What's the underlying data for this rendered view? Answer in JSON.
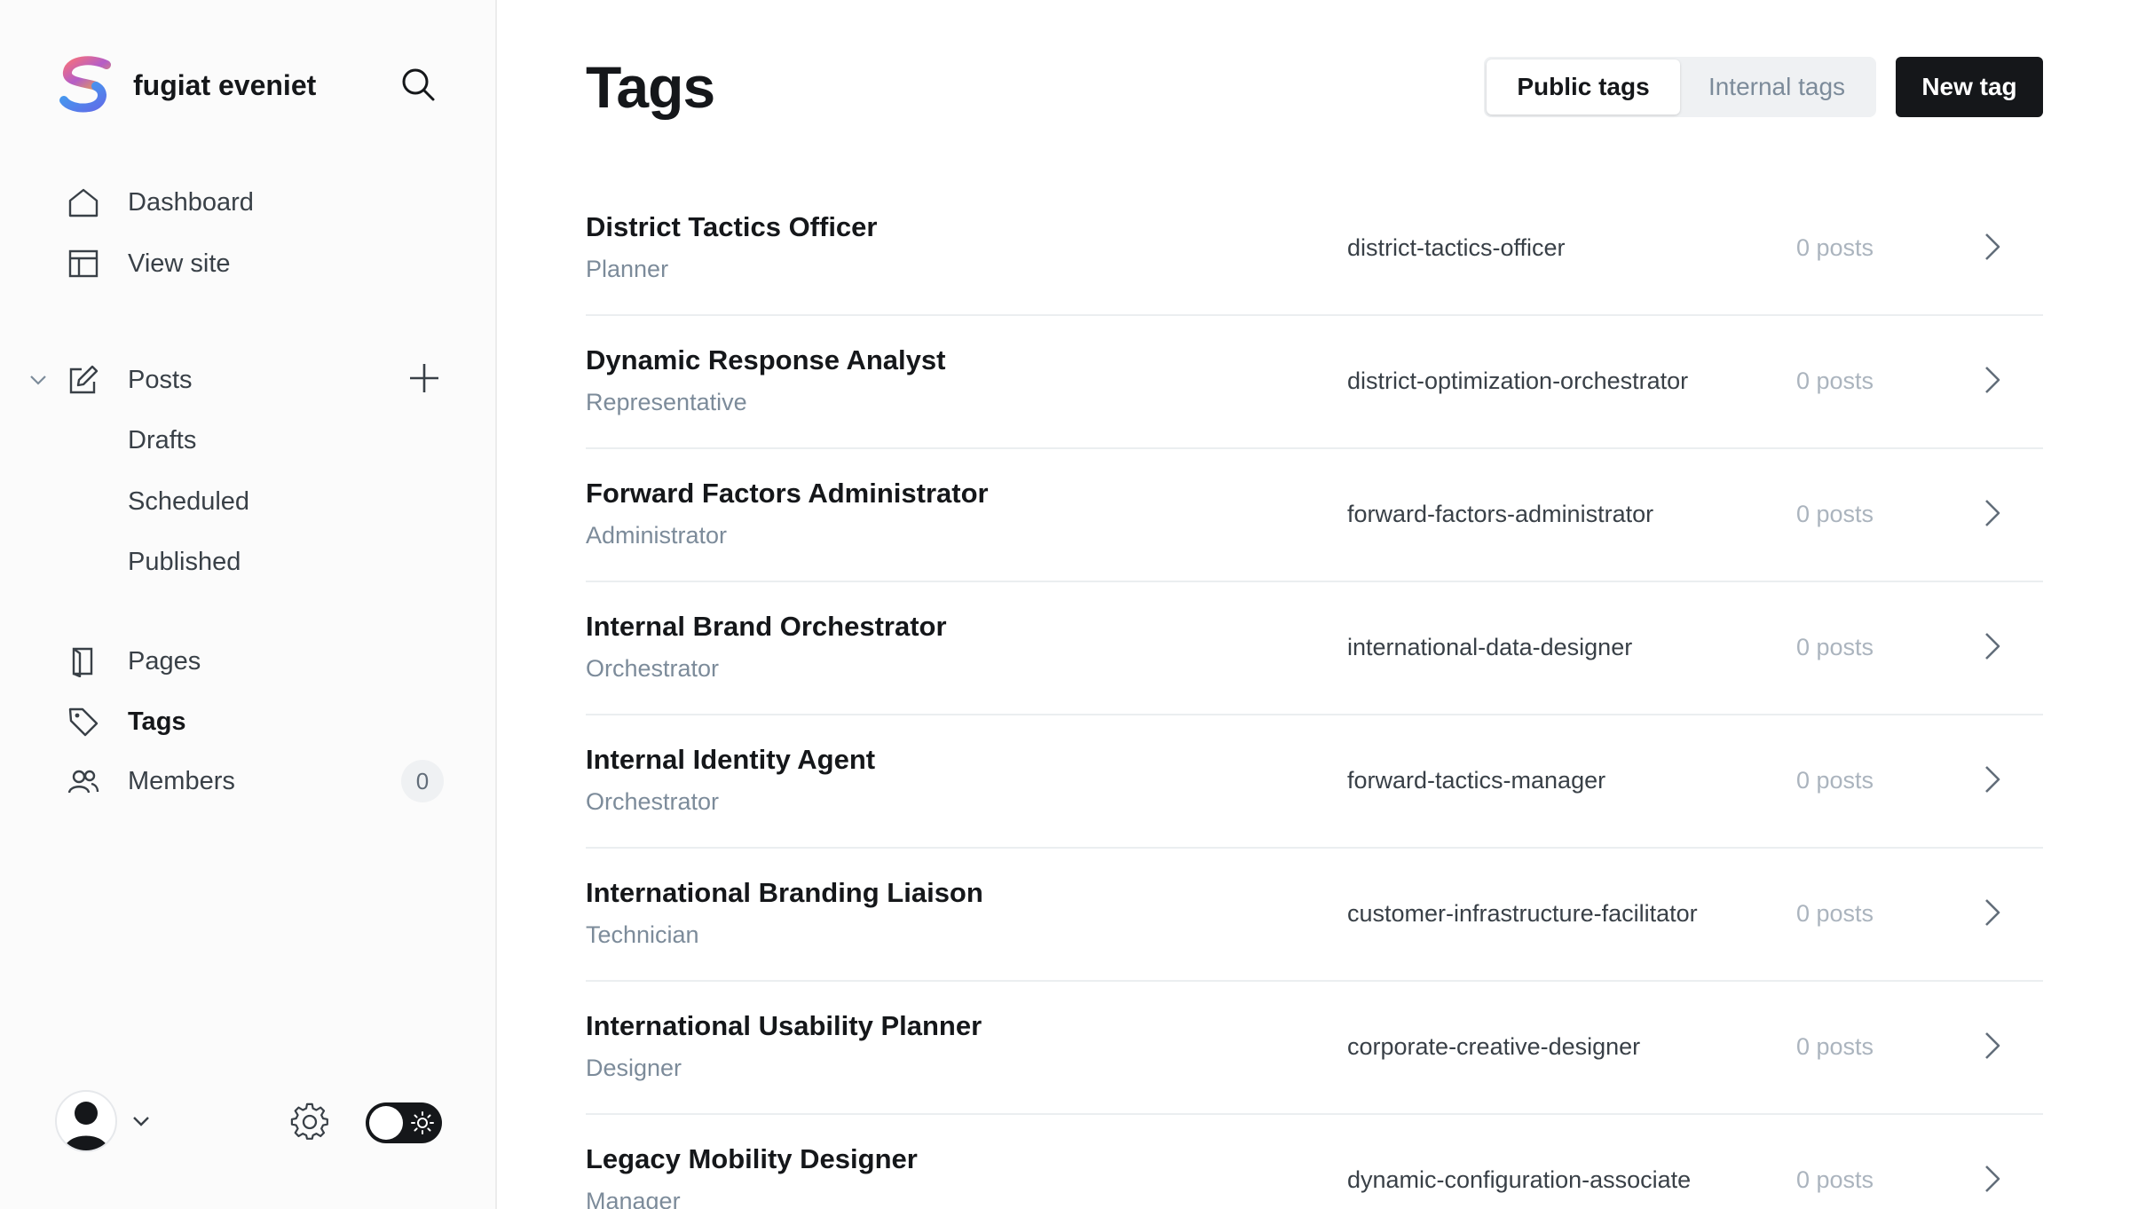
{
  "sidebar": {
    "brand_name": "fugiat eveniet",
    "nav": {
      "dashboard": "Dashboard",
      "view_site": "View site",
      "posts": "Posts",
      "drafts": "Drafts",
      "scheduled": "Scheduled",
      "published": "Published",
      "pages": "Pages",
      "tags": "Tags",
      "members": "Members",
      "members_count": "0"
    },
    "active_item": "Tags",
    "theme": "dark"
  },
  "header": {
    "title": "Tags",
    "tabs": {
      "public": "Public tags",
      "internal": "Internal tags",
      "active": "Public tags"
    },
    "new_tag_label": "New tag"
  },
  "tags": [
    {
      "name": "District Tactics Officer",
      "description": "Planner",
      "slug": "district-tactics-officer",
      "count": "0 posts"
    },
    {
      "name": "Dynamic Response Analyst",
      "description": "Representative",
      "slug": "district-optimization-orchestrator",
      "count": "0 posts"
    },
    {
      "name": "Forward Factors Administrator",
      "description": "Administrator",
      "slug": "forward-factors-administrator",
      "count": "0 posts"
    },
    {
      "name": "Internal Brand Orchestrator",
      "description": "Orchestrator",
      "slug": "international-data-designer",
      "count": "0 posts"
    },
    {
      "name": "Internal Identity Agent",
      "description": "Orchestrator",
      "slug": "forward-tactics-manager",
      "count": "0 posts"
    },
    {
      "name": "International Branding Liaison",
      "description": "Technician",
      "slug": "customer-infrastructure-facilitator",
      "count": "0 posts"
    },
    {
      "name": "International Usability Planner",
      "description": "Designer",
      "slug": "corporate-creative-designer",
      "count": "0 posts"
    },
    {
      "name": "Legacy Mobility Designer",
      "description": "Manager",
      "slug": "dynamic-configuration-associate",
      "count": "0 posts"
    }
  ],
  "colors": {
    "primary_text": "#15171a",
    "muted_text": "#7c8b9a",
    "faint_text": "#abb4be",
    "button_dark": "#15171a",
    "divider": "#ebeef0"
  }
}
